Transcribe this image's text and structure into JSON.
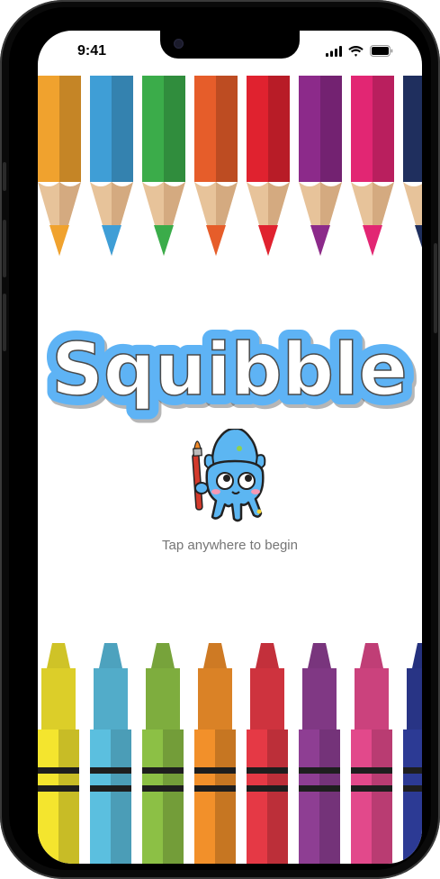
{
  "status_bar": {
    "time": "9:41",
    "icons": [
      "signal-icon",
      "wifi-icon",
      "battery-icon"
    ]
  },
  "app": {
    "title": "Squibble",
    "title_fill": "#ffffff",
    "title_outline": "#5eb3f5",
    "title_text_color": "#4a4a4a",
    "prompt": "Tap anywhere to begin",
    "mascot": "squid-mascot-holding-paintbrush"
  },
  "pencil_colors": [
    "#f0a22e",
    "#3f9ed6",
    "#3bac4a",
    "#e65d2a",
    "#e0222f",
    "#8c2a8a",
    "#e22673",
    "#1f2f5e"
  ],
  "crayon_colors": [
    "#f4e52e",
    "#5bbfdf",
    "#8cc045",
    "#f2902a",
    "#e53945",
    "#8e3e93",
    "#e2498b",
    "#2c3a94"
  ]
}
